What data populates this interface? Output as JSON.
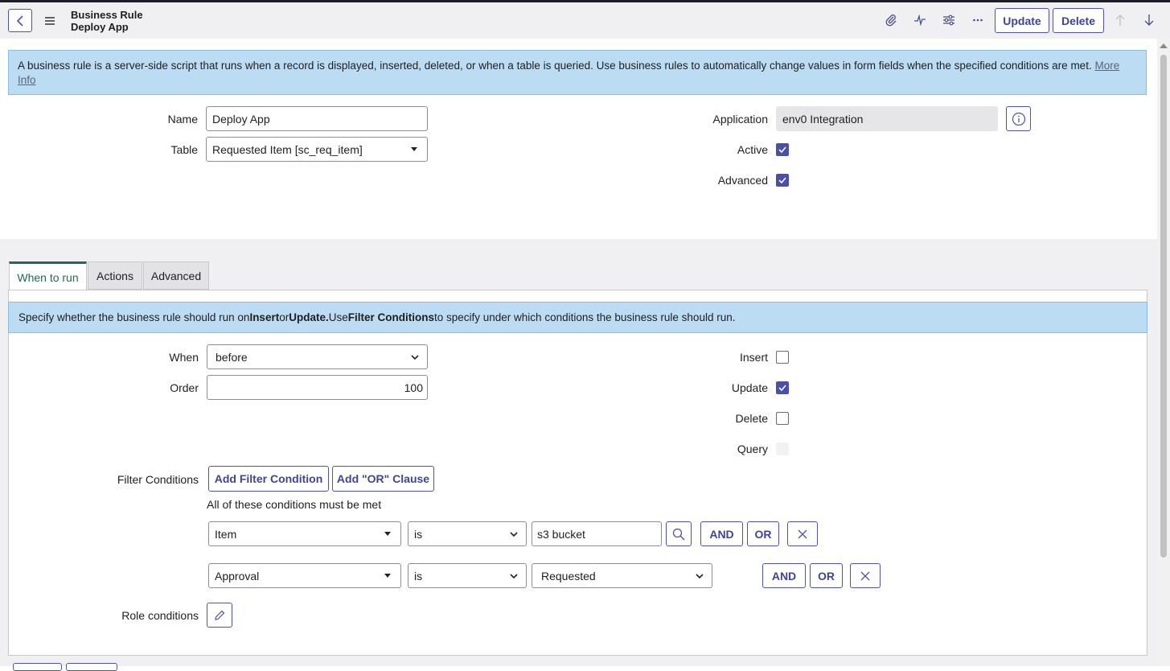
{
  "header": {
    "title_line1": "Business Rule",
    "title_line2": "Deploy App",
    "update_label": "Update",
    "delete_label": "Delete"
  },
  "info": {
    "text": "A business rule is a server-side script that runs when a record is displayed, inserted, deleted, or when a table is queried. Use business rules to automatically change values in form fields when the specified conditions are met. ",
    "link": "More Info"
  },
  "form": {
    "name_label": "Name",
    "name_value": "Deploy App",
    "table_label": "Table",
    "table_value": "Requested Item [sc_req_item]",
    "application_label": "Application",
    "application_value": "env0 Integration",
    "active_label": "Active",
    "active_checked": true,
    "advanced_label": "Advanced",
    "advanced_checked": true
  },
  "tabs": [
    {
      "label": "When to run",
      "active": true
    },
    {
      "label": "Actions",
      "active": false
    },
    {
      "label": "Advanced",
      "active": false
    }
  ],
  "when_to_run": {
    "banner_pre": "Specify whether the business rule should run on ",
    "banner_insert": "Insert",
    "banner_or": " or ",
    "banner_update": "Update.",
    "banner_use": " Use ",
    "banner_filter": "Filter Conditions",
    "banner_post": " to specify under which conditions the business rule should run.",
    "when_label": "When",
    "when_value": "before",
    "order_label": "Order",
    "order_value": "100",
    "insert_label": "Insert",
    "update_label": "Update",
    "delete_label": "Delete",
    "query_label": "Query",
    "filter_label": "Filter Conditions",
    "add_filter_label": "Add Filter Condition",
    "add_or_label": "Add \"OR\" Clause",
    "conditions_note": "All of these conditions must be met",
    "conditions": [
      {
        "field": "Item",
        "operator": "is",
        "value": "s3 bucket"
      },
      {
        "field": "Approval",
        "operator": "is",
        "value": "Requested"
      }
    ],
    "and_label": "AND",
    "or_label": "OR",
    "role_label": "Role conditions"
  },
  "colors": {
    "accent": "#4a50a6",
    "banner": "#bcdcf3",
    "active_tab": "#1d6b58"
  },
  "icons": [
    "chevron-left-icon",
    "menu-icon",
    "paperclip-icon",
    "activity-icon",
    "sliders-icon",
    "more-icon",
    "arrow-up-icon",
    "arrow-down-icon",
    "info-icon",
    "search-icon",
    "close-icon",
    "pencil-icon"
  ]
}
